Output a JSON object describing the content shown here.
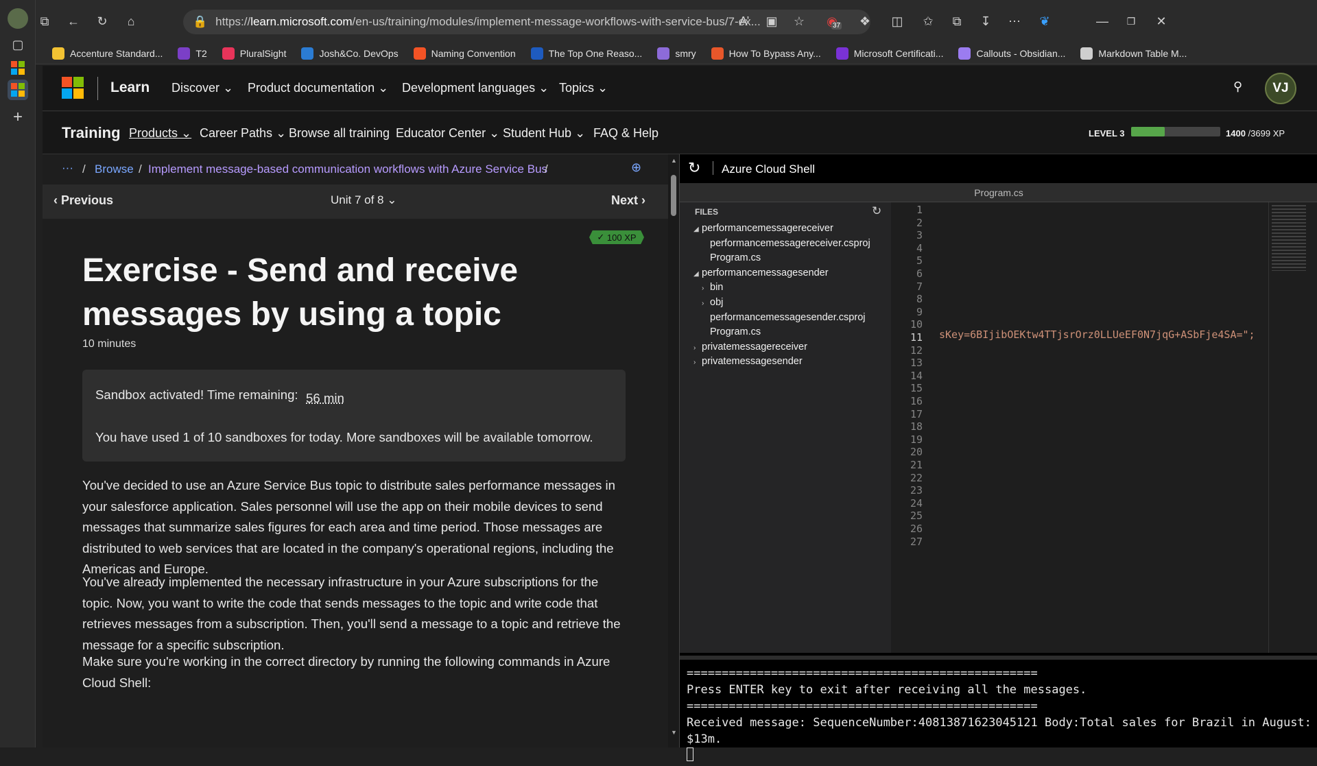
{
  "browser": {
    "url_prefix": "https://",
    "url_host": "learn.microsoft.com",
    "url_path": "/en-us/training/modules/implement-message-workflows-with-service-bus/7-ex...",
    "extension_badge": "37",
    "bookmarks": [
      {
        "label": "Accenture Standard...",
        "color": "#f2c233"
      },
      {
        "label": "T2",
        "color": "#7b3fc7"
      },
      {
        "label": "PluralSight",
        "color": "#e8345a"
      },
      {
        "label": "Josh&Co. DevOps",
        "color": "#2b7cd3"
      },
      {
        "label": "Naming Convention",
        "color": "#f35325"
      },
      {
        "label": "The Top One Reaso...",
        "color": "#1e5bbf"
      },
      {
        "label": "smry",
        "color": "#8d6bd9"
      },
      {
        "label": "How To Bypass Any...",
        "color": "#e8572a"
      },
      {
        "label": "Microsoft Certificati...",
        "color": "#7a32d6"
      },
      {
        "label": "Callouts - Obsidian...",
        "color": "#9b7cf0"
      },
      {
        "label": "Markdown Table M...",
        "color": "#cfcfcf"
      }
    ]
  },
  "learn_header": {
    "brand": "Learn",
    "nav": [
      "Discover",
      "Product documentation",
      "Development languages",
      "Topics"
    ],
    "avatar": "VJ"
  },
  "training_bar": {
    "title": "Training",
    "nav": [
      "Products",
      "Career Paths",
      "Browse all training",
      "Educator Center",
      "Student Hub",
      "FAQ & Help"
    ],
    "level": "LEVEL 3",
    "xp_current": "1400",
    "xp_total": "/3699 XP",
    "xp_progress": 0.38
  },
  "breadcrumb": {
    "ellipsis": "···",
    "items": [
      "Browse",
      "Implement message-based communication workflows with Azure Service Bus"
    ],
    "separator": "/"
  },
  "unit_nav": {
    "previous": "Previous",
    "unit": "Unit 7 of 8",
    "next": "Next"
  },
  "article": {
    "xp_badge": "100 XP",
    "title": "Exercise - Send and receive messages by using a topic",
    "duration": "10 minutes",
    "sandbox_text": "Sandbox activated! Time remaining:",
    "sandbox_time": "56 min",
    "sandbox_usage": "You have used 1 of 10 sandboxes for today. More sandboxes will be available tomorrow.",
    "paragraphs": [
      "You've decided to use an Azure Service Bus topic to distribute sales performance messages in your salesforce application. Sales personnel will use the app on their mobile devices to send messages that summarize sales figures for each area and time period. Those messages are distributed to web services that are located in the company's operational regions, including the Americas and Europe.",
      "You've already implemented the necessary infrastructure in your Azure subscriptions for the topic. Now, you want to write the code that sends messages to the topic and write code that retrieves messages from a subscription. Then, you'll send a message to a topic and retrieve the message for a specific subscription.",
      "Make sure you're working in the correct directory by running the following commands in Azure Cloud Shell:"
    ]
  },
  "cloud_shell": {
    "title": "Azure Cloud Shell",
    "open_file": "Program.cs",
    "files_label": "FILES",
    "tree": [
      {
        "label": "performancemessagereceiver",
        "indent": 0,
        "arrow": "◢"
      },
      {
        "label": "performancemessagereceiver.csproj",
        "indent": 1,
        "arrow": ""
      },
      {
        "label": "Program.cs",
        "indent": 1,
        "arrow": ""
      },
      {
        "label": "performancemessagesender",
        "indent": 0,
        "arrow": "◢"
      },
      {
        "label": "bin",
        "indent": 1,
        "arrow": "›"
      },
      {
        "label": "obj",
        "indent": 1,
        "arrow": "›"
      },
      {
        "label": "performancemessagesender.csproj",
        "indent": 1,
        "arrow": ""
      },
      {
        "label": "Program.cs",
        "indent": 1,
        "arrow": ""
      },
      {
        "label": "privatemessagereceiver",
        "indent": 0,
        "arrow": "›"
      },
      {
        "label": "privatemessagesender",
        "indent": 0,
        "arrow": "›"
      }
    ],
    "line_numbers": [
      "1",
      "2",
      "3",
      "4",
      "5",
      "6",
      "7",
      "8",
      "9",
      "10",
      "11",
      "12",
      "13",
      "14",
      "15",
      "16",
      "17",
      "18",
      "19",
      "20",
      "21",
      "22",
      "23",
      "24",
      "25",
      "26",
      "27"
    ],
    "active_line": "11",
    "code_line_11": "sKey=6BIjibOEKtw4TTjsrOrz0LLUeEF0N7jqG+ASbFje4SA=\";",
    "terminal_lines": [
      "==================================================",
      "Press ENTER key to exit after receiving all the messages.",
      "==================================================",
      "Received message: SequenceNumber:40813871623045121 Body:Total sales for Brazil in August:",
      "$13m."
    ]
  }
}
